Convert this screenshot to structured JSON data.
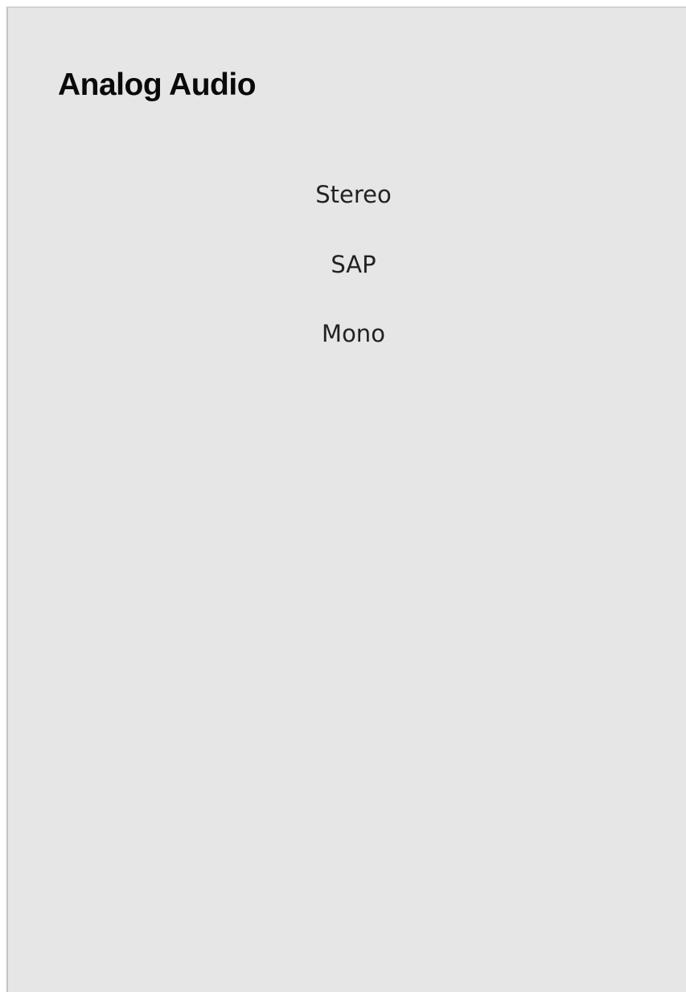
{
  "panel": {
    "title": "Analog Audio",
    "options": [
      {
        "label": "Stereo"
      },
      {
        "label": "SAP"
      },
      {
        "label": "Mono"
      }
    ]
  }
}
